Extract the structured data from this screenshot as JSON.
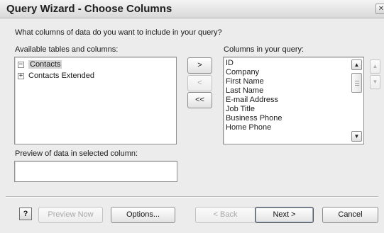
{
  "window": {
    "title": "Query Wizard - Choose Columns",
    "close_glyph": "✕"
  },
  "prompt": "What columns of data do you want to include in your query?",
  "available": {
    "label": "Available tables and columns:",
    "items": [
      {
        "label": "Contacts",
        "expander": "−",
        "selected": true
      },
      {
        "label": "Contacts Extended",
        "expander": "+",
        "selected": false
      }
    ]
  },
  "transfer_buttons": {
    "add": ">",
    "remove": "<",
    "remove_all": "<<"
  },
  "columns": {
    "label": "Columns in your query:",
    "items": [
      "ID",
      "Company",
      "First Name",
      "Last Name",
      "E-mail Address",
      "Job Title",
      "Business Phone",
      "Home Phone"
    ]
  },
  "preview": {
    "label": "Preview of data in selected column:",
    "value": ""
  },
  "footer": {
    "help_glyph": "?",
    "preview_now": "Preview Now",
    "options": "Options...",
    "back": "< Back",
    "next": "Next >",
    "cancel": "Cancel"
  },
  "icons": {
    "scroll_up": "scroll-up-arrow-icon",
    "scroll_down": "scroll-down-arrow-icon",
    "move_up": "move-up-icon",
    "move_down": "move-down-icon",
    "help": "help-icon"
  }
}
